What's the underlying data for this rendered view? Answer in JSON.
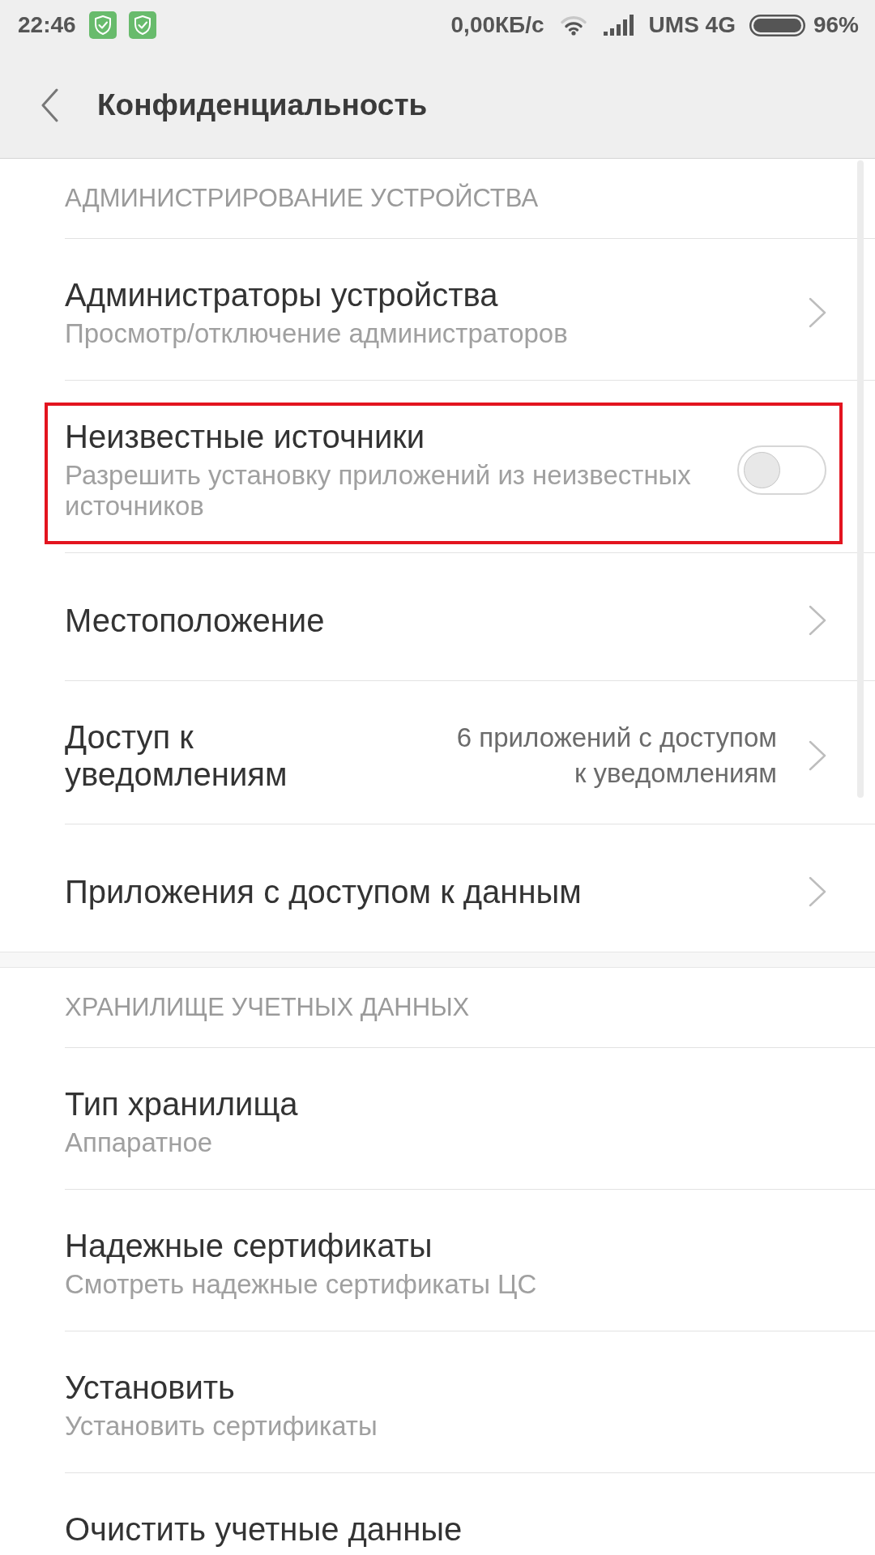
{
  "status_bar": {
    "time": "22:46",
    "speed": "0,00КБ/с",
    "carrier": "UMS 4G",
    "battery": "96%"
  },
  "header": {
    "title": "Конфиденциальность"
  },
  "sections": [
    {
      "title": "АДМИНИСТРИРОВАНИЕ УСТРОЙСТВА",
      "items": [
        {
          "kind": "link",
          "title": "Администраторы устройства",
          "subtitle": "Просмотр/отключение администраторов",
          "highlighted": false
        },
        {
          "kind": "toggle",
          "title": "Неизвестные источники",
          "subtitle": "Разрешить установку приложений из неизвестных источников",
          "checked": false,
          "highlighted": true
        },
        {
          "kind": "link",
          "title": "Местоположение",
          "highlighted": false
        },
        {
          "kind": "link",
          "title": "Доступ к уведомлениям",
          "value": "6 приложений с доступом к уведомлениям",
          "highlighted": false
        },
        {
          "kind": "link",
          "title": "Приложения с доступом к данным",
          "highlighted": false
        }
      ]
    },
    {
      "title": "ХРАНИЛИЩЕ УЧЕТНЫХ ДАННЫХ",
      "items": [
        {
          "kind": "info",
          "title": "Тип хранилища",
          "subtitle": "Аппаратное",
          "highlighted": false
        },
        {
          "kind": "action",
          "title": "Надежные сертификаты",
          "subtitle": "Смотреть надежные сертификаты ЦС",
          "highlighted": false
        },
        {
          "kind": "action",
          "title": "Установить",
          "subtitle": "Установить сертификаты",
          "highlighted": false
        },
        {
          "kind": "action",
          "title": "Очистить учетные данные",
          "highlighted": false
        }
      ]
    }
  ]
}
